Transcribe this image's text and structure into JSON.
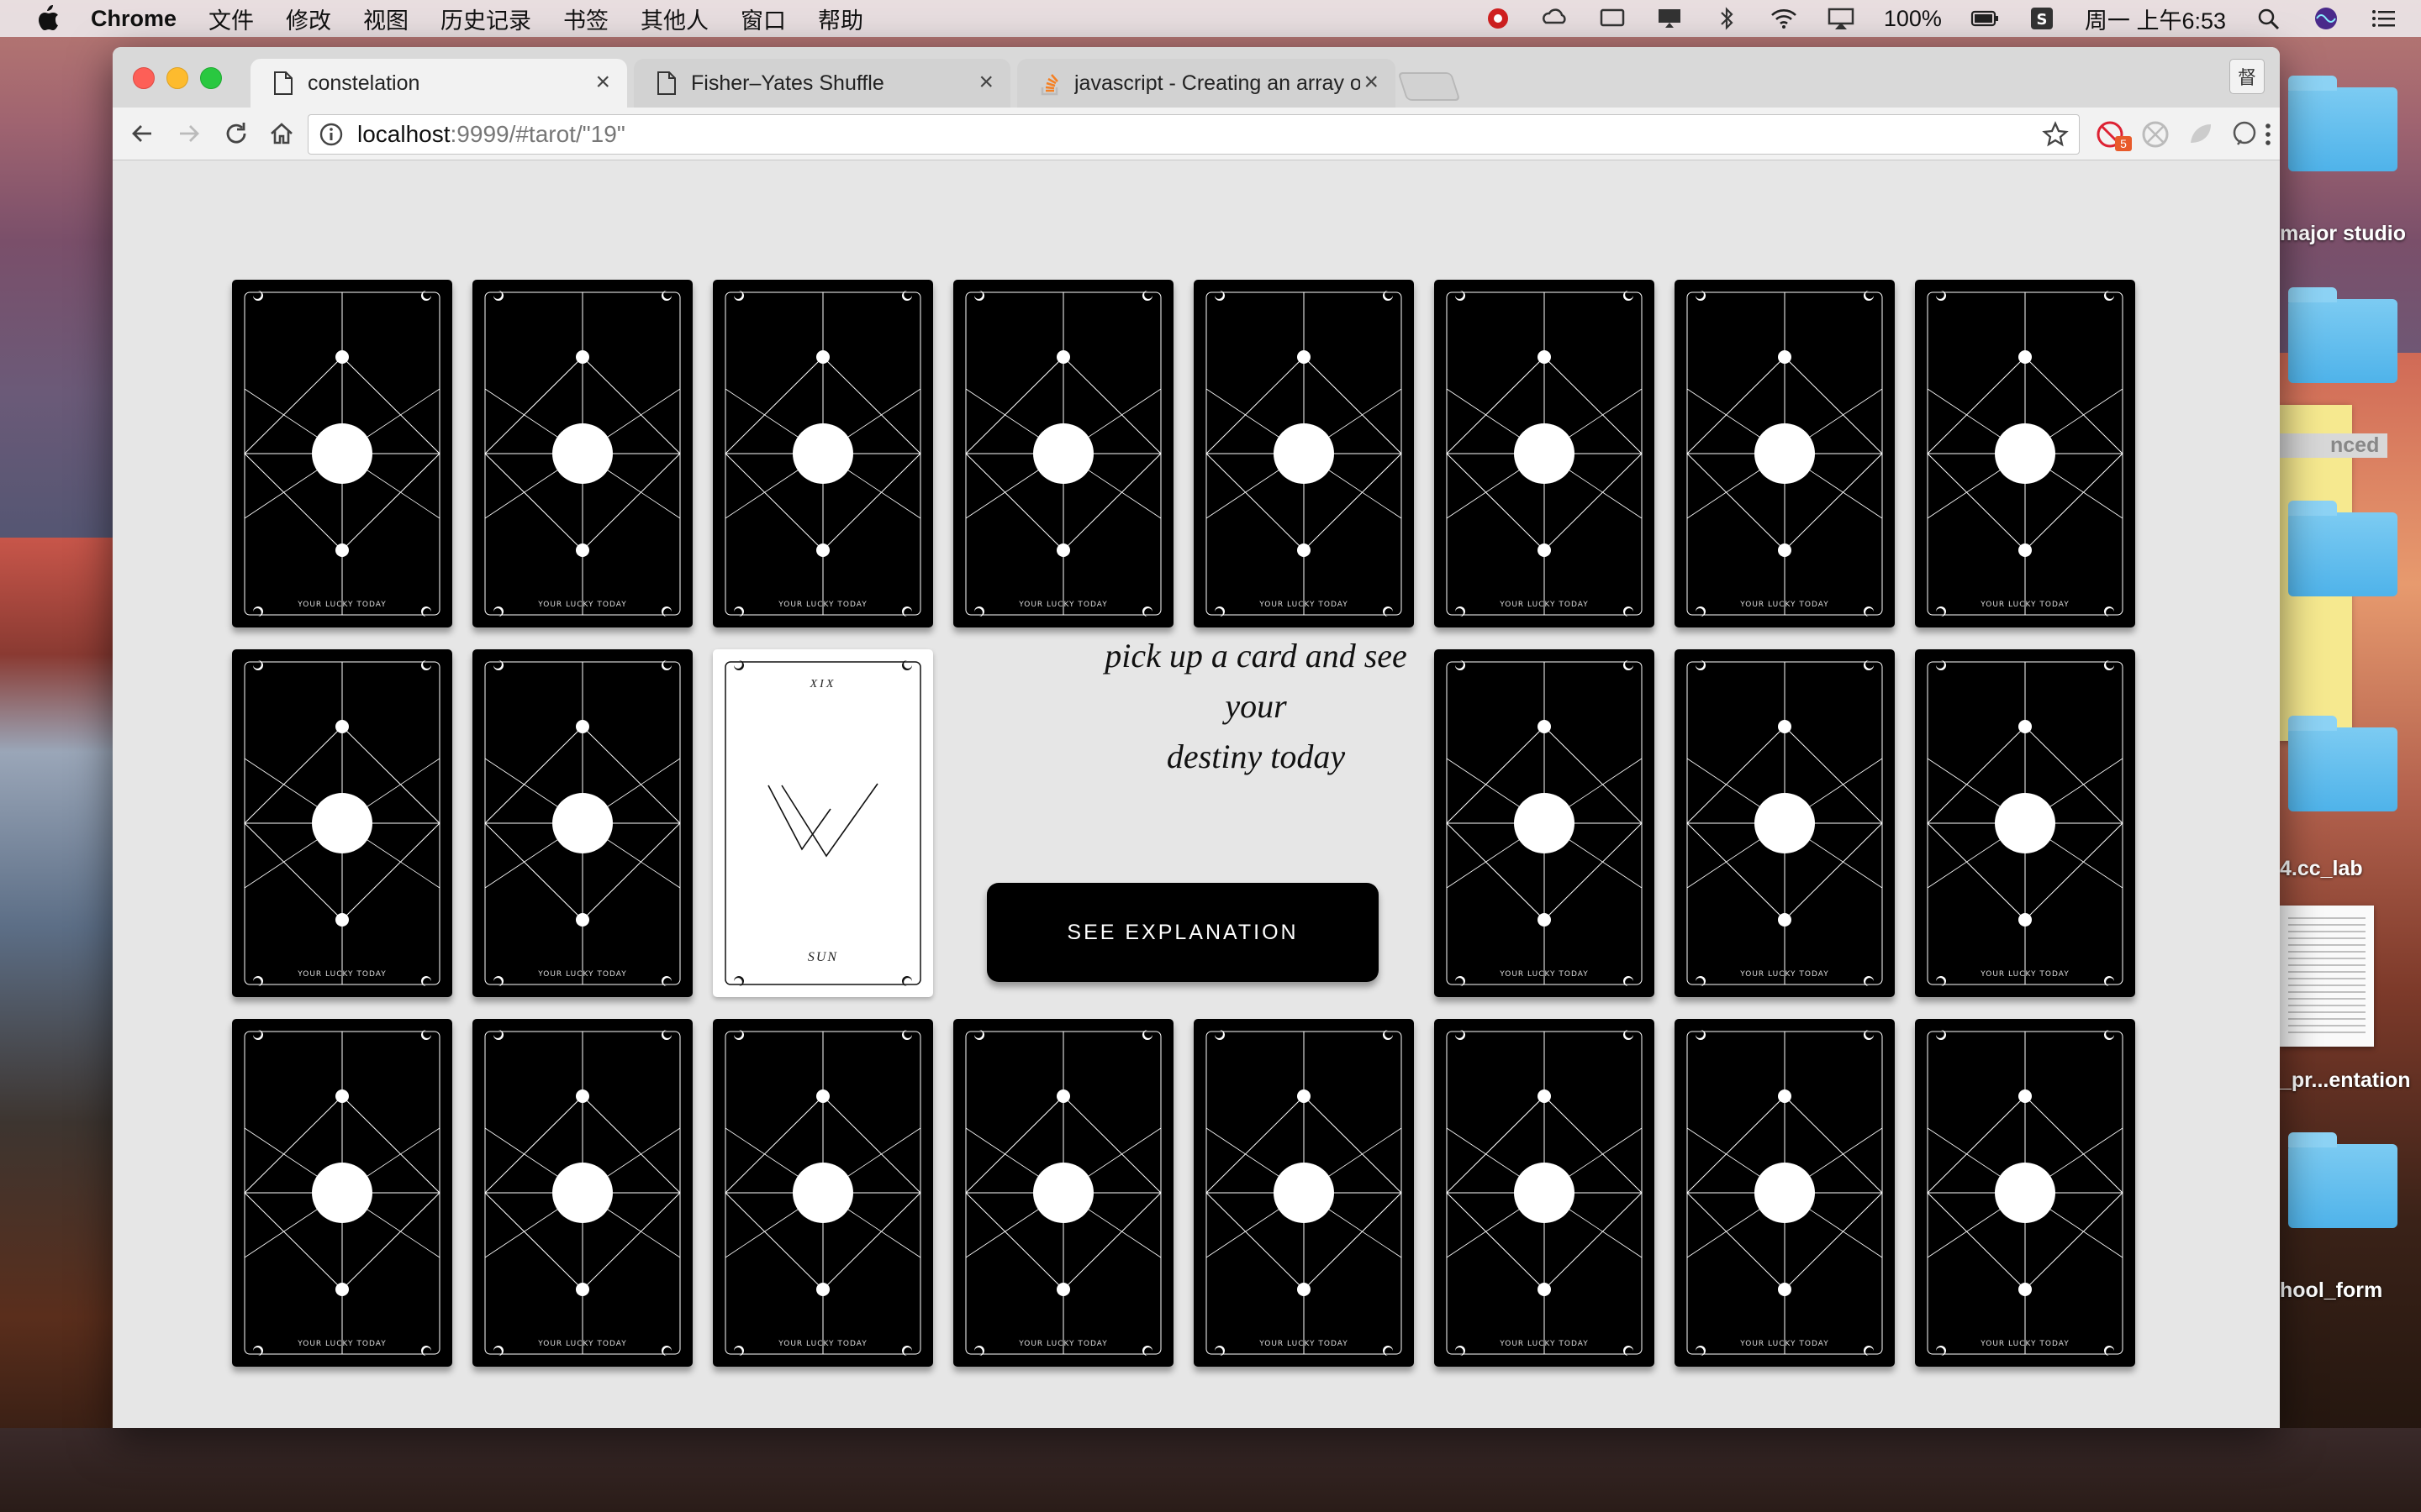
{
  "menubar": {
    "app_name": "Chrome",
    "items": [
      "文件",
      "修改",
      "视图",
      "历史记录",
      "书签",
      "其他人",
      "窗口",
      "帮助"
    ],
    "battery": "100%",
    "clock": "周一 上午6:53"
  },
  "desktop": {
    "labels": [
      "major studio",
      "nced",
      "4.cc_lab",
      "_pr...entation",
      "hool_form"
    ]
  },
  "browser": {
    "tabs": [
      {
        "title": "constelation",
        "active": true
      },
      {
        "title": "Fisher–Yates Shuffle",
        "active": false
      },
      {
        "title": "javascript - Creating an array o",
        "active": false
      }
    ],
    "profile_label": "督",
    "url": {
      "host": "localhost",
      "path": ":9999/#tarot/\"19\""
    },
    "extension_badge": "5"
  },
  "page": {
    "card_caption": "YOUR LUCKY TODAY",
    "revealed_card": {
      "numeral": "XIX",
      "name": "SUN"
    },
    "prompt_line1": "pick up a card and see your",
    "prompt_line2": "destiny today",
    "explain_button": "SEE EXPLANATION"
  }
}
